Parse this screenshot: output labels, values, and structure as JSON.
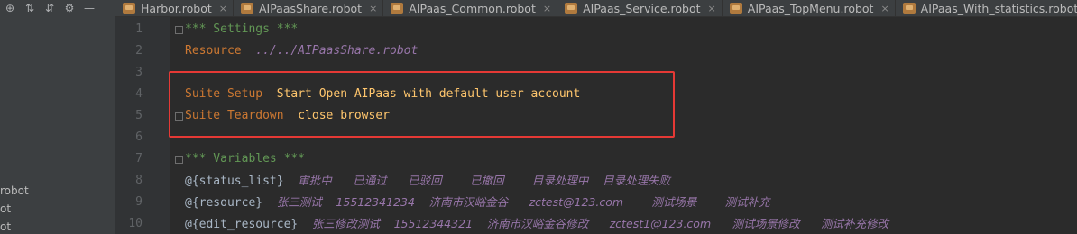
{
  "sidebar": {
    "items": [
      "robot",
      "ot",
      "ot"
    ]
  },
  "tabs": [
    {
      "label": "Harbor.robot"
    },
    {
      "label": "AIPaasShare.robot"
    },
    {
      "label": "AIPaas_Common.robot"
    },
    {
      "label": "AIPaas_Service.robot"
    },
    {
      "label": "AIPaas_TopMenu.robot"
    },
    {
      "label": "AIPaas_With_statistics.robot"
    }
  ],
  "line_numbers": [
    "1",
    "2",
    "3",
    "4",
    "5",
    "6",
    "7",
    "8",
    "9",
    "10"
  ],
  "code": {
    "l1": "*** Settings ***",
    "l2_kw": "Resource",
    "l2_val": "../../AIPaasShare.robot",
    "l4_kw": "Suite Setup",
    "l4_val": "Start Open AIPaas with default user account",
    "l5_kw": "Suite Teardown",
    "l5_val": "close browser",
    "l7": "*** Variables ***",
    "l8_var": "@{status_list}",
    "l8_vals": [
      "审批中",
      "已通过",
      "已驳回",
      "已撤回",
      "目录处理中",
      "目录处理失败"
    ],
    "l9_var": "@{resource}",
    "l9_vals": [
      "张三测试",
      "15512341234",
      "济南市汉峪金谷",
      "zctest@123.com",
      "测试场景",
      "测试补充"
    ],
    "l10_var": "@{edit_resource}",
    "l10_vals": [
      "张三修改测试",
      "15512344321",
      "济南市汉峪金谷修改",
      "zctest1@123.com",
      "测试场景修改",
      "测试补充修改"
    ]
  },
  "colors": {
    "highlight_box": "#e53935",
    "keyword": "#cc7832",
    "header": "#629755",
    "value": "#ffc66d"
  }
}
